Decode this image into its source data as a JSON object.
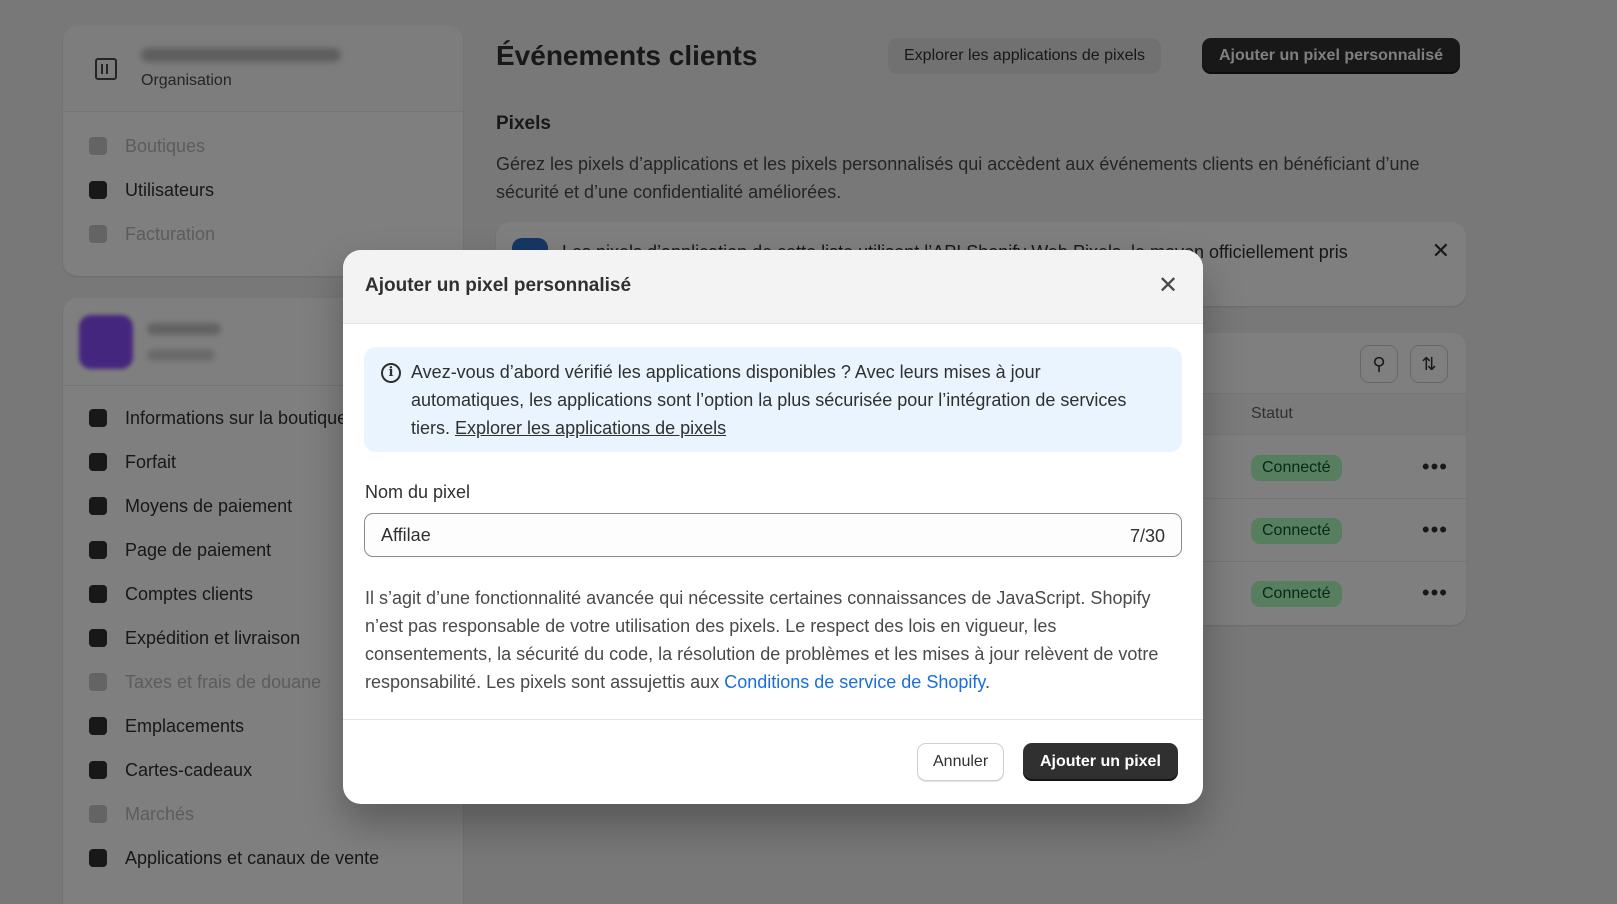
{
  "sidebar": {
    "org": {
      "name": "",
      "subtitle": "Organisation"
    },
    "org_items": [
      {
        "label": "Boutiques",
        "icon": "store-icon",
        "disabled": true
      },
      {
        "label": "Utilisateurs",
        "icon": "users-icon",
        "disabled": false
      },
      {
        "label": "Facturation",
        "icon": "receipt-icon",
        "disabled": true
      }
    ],
    "shop_items": [
      {
        "label": "Informations sur la boutique",
        "icon": "store-icon"
      },
      {
        "label": "Forfait",
        "icon": "plan-icon"
      },
      {
        "label": "Moyens de paiement",
        "icon": "payment-icon"
      },
      {
        "label": "Page de paiement",
        "icon": "cart-icon"
      },
      {
        "label": "Comptes clients",
        "icon": "person-icon"
      },
      {
        "label": "Expédition et livraison",
        "icon": "truck-icon"
      },
      {
        "label": "Taxes et frais de douane",
        "icon": "tax-icon"
      },
      {
        "label": "Emplacements",
        "icon": "location-icon"
      },
      {
        "label": "Cartes-cadeaux",
        "icon": "gift-card-icon"
      },
      {
        "label": "Marchés",
        "icon": "globe-icon"
      },
      {
        "label": "Applications et canaux de vente",
        "icon": "apps-icon"
      }
    ]
  },
  "main": {
    "title": "Événements clients",
    "explore_button": "Explorer les applications de pixels",
    "add_custom_button": "Ajouter un pixel personnalisé",
    "section_title": "Pixels",
    "section_desc": "Gérez les pixels d’applications et les pixels personnalisés qui accèdent aux événements clients en bénéficiant d’une sécurité et d’une confidentialité améliorées.",
    "banner_text": "Les pixels d’application de cette liste utilisent l’API Shopify Web Pixels, le moyen officiellement pris",
    "table": {
      "status_header": "Statut",
      "rows": [
        {
          "status": "Connecté"
        },
        {
          "status": "Connecté"
        },
        {
          "status": "Connecté"
        }
      ]
    }
  },
  "modal": {
    "title": "Ajouter un pixel personnalisé",
    "info_text": "Avez-vous d’abord vérifié les applications disponibles ? Avec leurs mises à jour automatiques, les applications sont l’option la plus sécurisée pour l’intégration de services tiers. ",
    "info_link": "Explorer les applications de pixels",
    "field_label": "Nom du pixel",
    "field_value": "Affilae",
    "field_count": "7/30",
    "disclaimer": "Il s’agit d’une fonctionnalité avancée qui nécessite certaines connaissances de JavaScript. Shopify n’est pas responsable de votre utilisation des pixels. Le respect des lois en vigueur, les consentements, la sécurité du code, la résolution de problèmes et les mises à jour relèvent de votre responsabilité. Les pixels sont assujettis aux ",
    "terms_link": "Conditions de service de Shopify",
    "terms_suffix": ".",
    "cancel_button": "Annuler",
    "add_button": "Ajouter un pixel"
  }
}
